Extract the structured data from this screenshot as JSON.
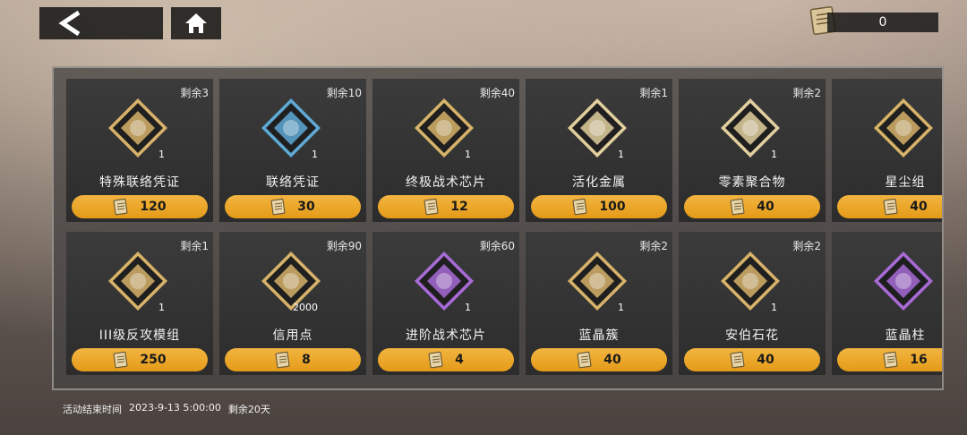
{
  "currency": {
    "amount": "0",
    "icon": "voucher-icon"
  },
  "nav": {
    "back_icon": "back-arrow-icon",
    "home_icon": "home-icon"
  },
  "items_row1": [
    {
      "name": "特殊联络凭证",
      "remain": "剩余3",
      "count": "1",
      "price": "120",
      "color": "#d7b36a",
      "icon": "contact-card-icon"
    },
    {
      "name": "联络凭证",
      "remain": "剩余10",
      "count": "1",
      "price": "30",
      "color": "#5fa9d6",
      "icon": "military-card-icon"
    },
    {
      "name": "终极战术芯片",
      "remain": "剩余40",
      "count": "1",
      "price": "12",
      "color": "#d7b36a",
      "icon": "exp-chip-icon"
    },
    {
      "name": "活化金属",
      "remain": "剩余1",
      "count": "1",
      "price": "100",
      "color": "#e2cf9d",
      "icon": "metal-capsule-icon"
    },
    {
      "name": "零素聚合物",
      "remain": "剩余2",
      "count": "1",
      "price": "40",
      "color": "#e2cf9d",
      "icon": "polymer-icon"
    },
    {
      "name": "星尘组",
      "remain": "",
      "count": "",
      "price": "40",
      "color": "#d7b36a",
      "icon": "hourglass-icon"
    }
  ],
  "items_row2": [
    {
      "name": "III级反攻模组",
      "remain": "剩余1",
      "count": "1",
      "price": "250",
      "color": "#d7b36a",
      "icon": "module-icon"
    },
    {
      "name": "信用点",
      "remain": "剩余90",
      "count": "2000",
      "price": "8",
      "color": "#d7b36a",
      "icon": "credit-coin-icon"
    },
    {
      "name": "进阶战术芯片",
      "remain": "剩余60",
      "count": "1",
      "price": "4",
      "color": "#a76bd6",
      "icon": "exp-chip-purple-icon"
    },
    {
      "name": "蓝晶簇",
      "remain": "剩余2",
      "count": "1",
      "price": "40",
      "color": "#d7b36a",
      "icon": "crystal-cluster-icon"
    },
    {
      "name": "安伯石花",
      "remain": "剩余2",
      "count": "1",
      "price": "40",
      "color": "#d7b36a",
      "icon": "stone-flower-icon"
    },
    {
      "name": "蓝晶柱",
      "remain": "",
      "count": "",
      "price": "16",
      "color": "#a76bd6",
      "icon": "crystal-pillar-icon"
    }
  ],
  "footer": {
    "label": "活动结束时间",
    "datetime": "2023-9-13 5:00:00",
    "remaining": "剩余20天"
  }
}
